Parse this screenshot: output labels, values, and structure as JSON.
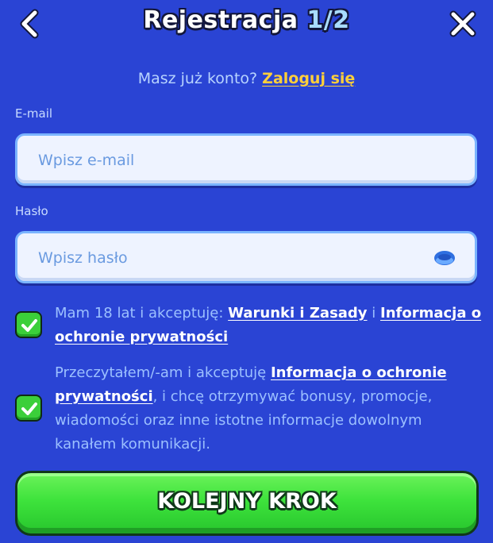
{
  "header": {
    "title_main": "Rejestracja ",
    "title_step": "1/2",
    "back_icon": "chevron-left-icon",
    "close_icon": "close-icon"
  },
  "login_prompt": {
    "text": "Masz już konto? ",
    "link": "Zaloguj się"
  },
  "email": {
    "label": "E-mail",
    "placeholder": "Wpisz e-mail",
    "value": ""
  },
  "password": {
    "label": "Hasło",
    "placeholder": "Wpisz hasło",
    "value": "",
    "toggle_icon": "eye-icon"
  },
  "consent_terms": {
    "checked": true,
    "text_before": "Mam 18 lat i akceptuję: ",
    "link_terms": "Warunki i Zasady",
    "text_mid": " i ",
    "link_privacy": "Informacja o ochronie prywatności"
  },
  "consent_marketing": {
    "checked": true,
    "text_before": "Przeczytałem/-am i akceptuję ",
    "link_privacy": "Informacja o ochronie prywatności",
    "text_after": ", i chcę otrzymywać bonusy, promocje, wiadomości oraz inne istotne informacje dowolnym kanałem komunikacji."
  },
  "next_button": {
    "label": "KOLEJNY KROK"
  },
  "colors": {
    "background": "#2a44d4",
    "link_yellow": "#ffcf3a",
    "button_green": "#3ee33c",
    "input_border": "#7ab4ff"
  }
}
